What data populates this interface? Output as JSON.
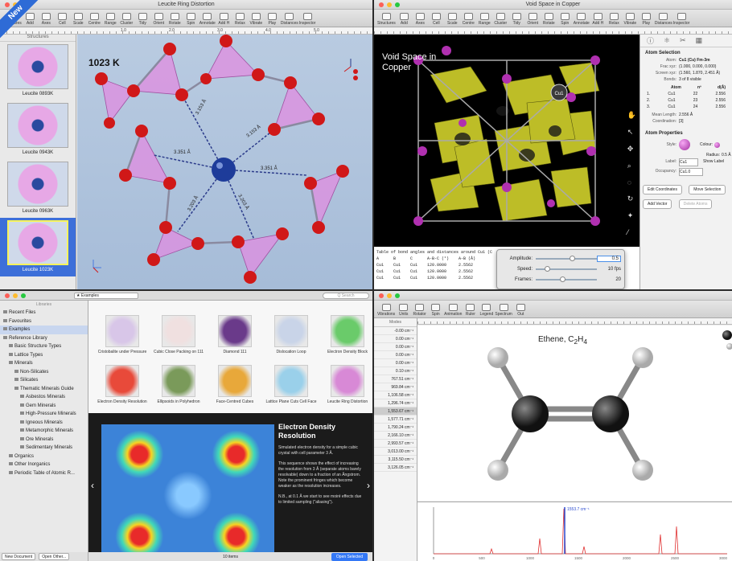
{
  "badge": "New",
  "window1": {
    "title": "Leucite Ring Distortion",
    "toolbar": [
      "Structures",
      "Add",
      "Axes",
      "Cell",
      "Scale",
      "Centre",
      "Range",
      "Cluster",
      "Tidy",
      "Orient",
      "Rotate",
      "Spin",
      "Annotate",
      "Add H",
      "Relax",
      "Vibrate",
      "Play",
      "Distances",
      "Inspector"
    ],
    "ruler": [
      "1.0",
      "2.0",
      "3.0",
      "4.0",
      "5.0"
    ],
    "sidebar_header": "Structures",
    "thumbs": [
      "Leucite 0893K",
      "Leucite 0943K",
      "Leucite 0963K",
      "Leucite 1023K"
    ],
    "temperature": "1023 K",
    "distances": [
      "3.153 Å",
      "3.153 Å",
      "3.351 Å",
      "3.351 Å",
      "3.203 Å",
      "3.203 Å"
    ]
  },
  "window2": {
    "title": "Void Space in Copper",
    "toolbar": [
      "Structures",
      "Add",
      "Axes",
      "Cell",
      "Scale",
      "Centre",
      "Range",
      "Cluster",
      "Tidy",
      "Orient",
      "Rotate",
      "Spin",
      "Annotate",
      "Add H",
      "Relax",
      "Vibrate",
      "Play",
      "Distances",
      "Inspector"
    ],
    "view_title": "Void Space in Copper",
    "atom_label": "Cu1",
    "inspector": {
      "atom_selection": "Atom Selection",
      "atom_label": "Atom:",
      "atom_value": "Cu1 (Cu) Fm-3m",
      "frac_label": "Frac xyz:",
      "frac_value": "(1.000, 0.000, 0.000)",
      "screen_label": "Screen xyz:",
      "screen_value": "(1.560, 1.870, 2.451 Å)",
      "bonds_label": "Bonds:",
      "bonds_value": "3 of 8 visible",
      "bond_cols": [
        "Atom",
        "nº",
        "d(Å)"
      ],
      "bond_rows": [
        [
          "1.",
          "Cu1",
          "22",
          "2.556"
        ],
        [
          "2.",
          "Cu1",
          "23",
          "2.556"
        ],
        [
          "3.",
          "Cu1",
          "24",
          "2.556"
        ]
      ],
      "mean_label": "Mean Length:",
      "mean_value": "2.556 Å",
      "coord_label": "Coordination:",
      "coord_value": "[3]",
      "atom_props": "Atom Properties",
      "style_label": "Style:",
      "colour_label": "Colour:",
      "radius_label": "Radius:",
      "radius_value": "0.5 Å",
      "label_label": "Label:",
      "label_value": "Cu1",
      "show_label": "Show Label",
      "occ_label": "Occupancy:",
      "occ_value": "Cu1.0",
      "btn_edit": "Edit Coordinates",
      "btn_move": "Move Selection",
      "btn_vector": "Add Vector",
      "btn_delete": "Delete Atoms"
    },
    "table_title": "Table of bond angles and distances around Cu1 (C",
    "table_rows": [
      "A      B      C      A-B-C (°)    A-B (Å)",
      "",
      "Cu1    Cu1    Cu1    120.0000     2.5562",
      "Cu1    Cu1    Cu1    120.0000     2.5562",
      "",
      "Cu1    Cu1    Cu1    120.0000     2.5562"
    ],
    "popup": {
      "amplitude_label": "Amplitude:",
      "amplitude_value": "0.5",
      "speed_label": "Speed:",
      "speed_value": "10 fps",
      "frames_label": "Frames:",
      "frames_value": "20"
    }
  },
  "window3": {
    "crumb": "Examples",
    "search_placeholder": "Q Search",
    "lib_header": "Libraries",
    "library": [
      {
        "label": "Recent Files",
        "indent": 0,
        "sel": false
      },
      {
        "label": "Favourites",
        "indent": 0,
        "sel": false
      },
      {
        "label": "Examples",
        "indent": 0,
        "sel": true
      },
      {
        "label": "Reference Library",
        "indent": 0,
        "sel": false
      },
      {
        "label": "Basic Structure Types",
        "indent": 1,
        "sel": false
      },
      {
        "label": "Lattice Types",
        "indent": 1,
        "sel": false
      },
      {
        "label": "Minerals",
        "indent": 1,
        "sel": false
      },
      {
        "label": "Non-Silicates",
        "indent": 2,
        "sel": false
      },
      {
        "label": "Silicates",
        "indent": 2,
        "sel": false
      },
      {
        "label": "Thematic Minerals Guide",
        "indent": 2,
        "sel": false
      },
      {
        "label": "Asbestos Minerals",
        "indent": 3,
        "sel": false
      },
      {
        "label": "Gem Minerals",
        "indent": 3,
        "sel": false
      },
      {
        "label": "High-Pressure Minerals",
        "indent": 3,
        "sel": false
      },
      {
        "label": "Igneous Minerals",
        "indent": 3,
        "sel": false
      },
      {
        "label": "Metamorphic Minerals",
        "indent": 3,
        "sel": false
      },
      {
        "label": "Ore Minerals",
        "indent": 3,
        "sel": false
      },
      {
        "label": "Sedimentary Minerals",
        "indent": 3,
        "sel": false
      },
      {
        "label": "Organics",
        "indent": 1,
        "sel": false
      },
      {
        "label": "Other Inorganics",
        "indent": 1,
        "sel": false
      },
      {
        "label": "Periodic Table of Atomic R...",
        "indent": 1,
        "sel": false
      }
    ],
    "btn_new": "New Document",
    "btn_open_other": "Open Other...",
    "grid": [
      {
        "label": "Cristobalite under Pressure",
        "color": "#d8c6e8"
      },
      {
        "label": "Cubic Close Packing on 111",
        "color": "#f0e0e0"
      },
      {
        "label": "Diamond 111",
        "color": "#6a3a8a"
      },
      {
        "label": "Dislocation Loop",
        "color": "#c9d4e8"
      },
      {
        "label": "Electron Density Block",
        "color": "#6acb6a"
      },
      {
        "label": "Electron Density Resolution",
        "color": "#e84a3a"
      },
      {
        "label": "Ellipsoids in Polyhedron",
        "color": "#7a9a5a"
      },
      {
        "label": "Face-Centred Cubes",
        "color": "#e8a83a"
      },
      {
        "label": "Lattice Plane Cuts Cell Face",
        "color": "#9ad0ea"
      },
      {
        "label": "Leucite Ring Distortion",
        "color": "#d889d6"
      }
    ],
    "detail_title": "Electron Density Resolution",
    "detail_p1": "Simulated electron density for a simple cubic crystal with cell parameter 3 Å.",
    "detail_p2": "This sequence shows the effect of increasing the resolution from 3 Å (separate atoms barely resolvable) down to a fraction of an Ångstrom. Note the prominent fringes which become weaker as the resolution increases.",
    "detail_p3": "N.B., at 0.1 Å we start to see moiré effects due to limited sampling (\"aliasing\").",
    "footer_count": "10 items",
    "open_btn": "Open Selected"
  },
  "window4": {
    "toolbar": [
      "Vibrations",
      "Units",
      "Rotator",
      "Spin",
      "Animation",
      "Ruler",
      "Legend",
      "Spectrum",
      "Out"
    ],
    "modes_header": "Modes",
    "modes": [
      "-0.00 cm⁻¹",
      "0.00 cm⁻¹",
      "0.00 cm⁻¹",
      "0.00 cm⁻¹",
      "0.00 cm⁻¹",
      "0.10 cm⁻¹",
      "767.51 cm⁻¹",
      "969.84 cm⁻¹",
      "1,106.58 cm⁻¹",
      "1,296.74 cm⁻¹",
      "1,553.67 cm⁻¹",
      "1,577.71 cm⁻¹",
      "1,790.24 cm⁻¹",
      "2,166.10 cm⁻¹",
      "2,993.57 cm⁻¹",
      "3,013.00 cm⁻¹",
      "3,115.50 cm⁻¹",
      "3,126.05 cm⁻¹"
    ],
    "selected_mode": 10,
    "molecule_name": "Ethene, C",
    "molecule_sub": "2",
    "molecule_h": "H",
    "molecule_sub2": "4",
    "peak_label": "1553.7 cm⁻¹",
    "spec_ticks": [
      "0",
      "500",
      "1000",
      "1500",
      "2000",
      "2500",
      "3000"
    ]
  }
}
